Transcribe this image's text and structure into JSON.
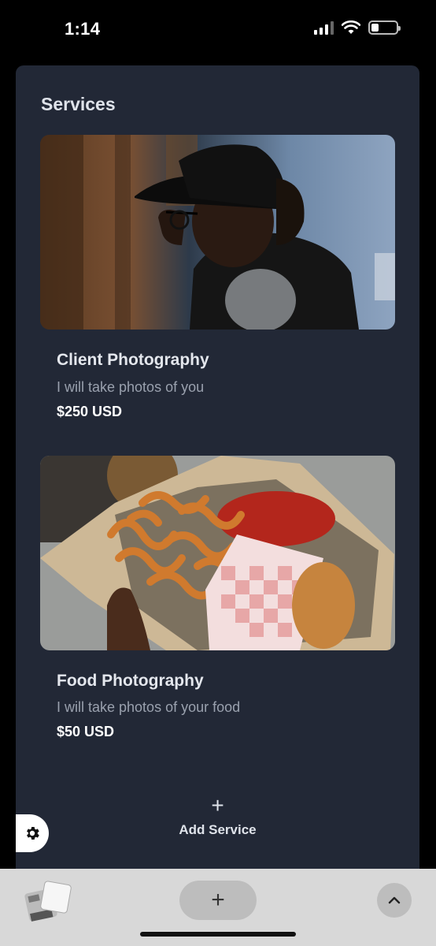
{
  "status_bar": {
    "time": "1:14",
    "icons": [
      "signal-icon",
      "wifi-icon",
      "battery-icon"
    ]
  },
  "services": {
    "title": "Services",
    "items": [
      {
        "name": "Client Photography",
        "description": "I will take photos of you",
        "price": "$250 USD",
        "image": "portrait-photo"
      },
      {
        "name": "Food Photography",
        "description": "I will take photos of your food",
        "price": "$50 USD",
        "image": "food-photo"
      }
    ],
    "add_label": "Add Service",
    "add_icon": "plus-icon"
  },
  "bottom_bar": {
    "icons": [
      "tabs-icon",
      "plus-icon",
      "chevron-up-icon"
    ]
  },
  "colors": {
    "background": "#000000",
    "panel": "#222836",
    "title": "#dfe3ea",
    "muted_text": "#9aa1ae",
    "bottom_bar": "#d8d8d8"
  }
}
